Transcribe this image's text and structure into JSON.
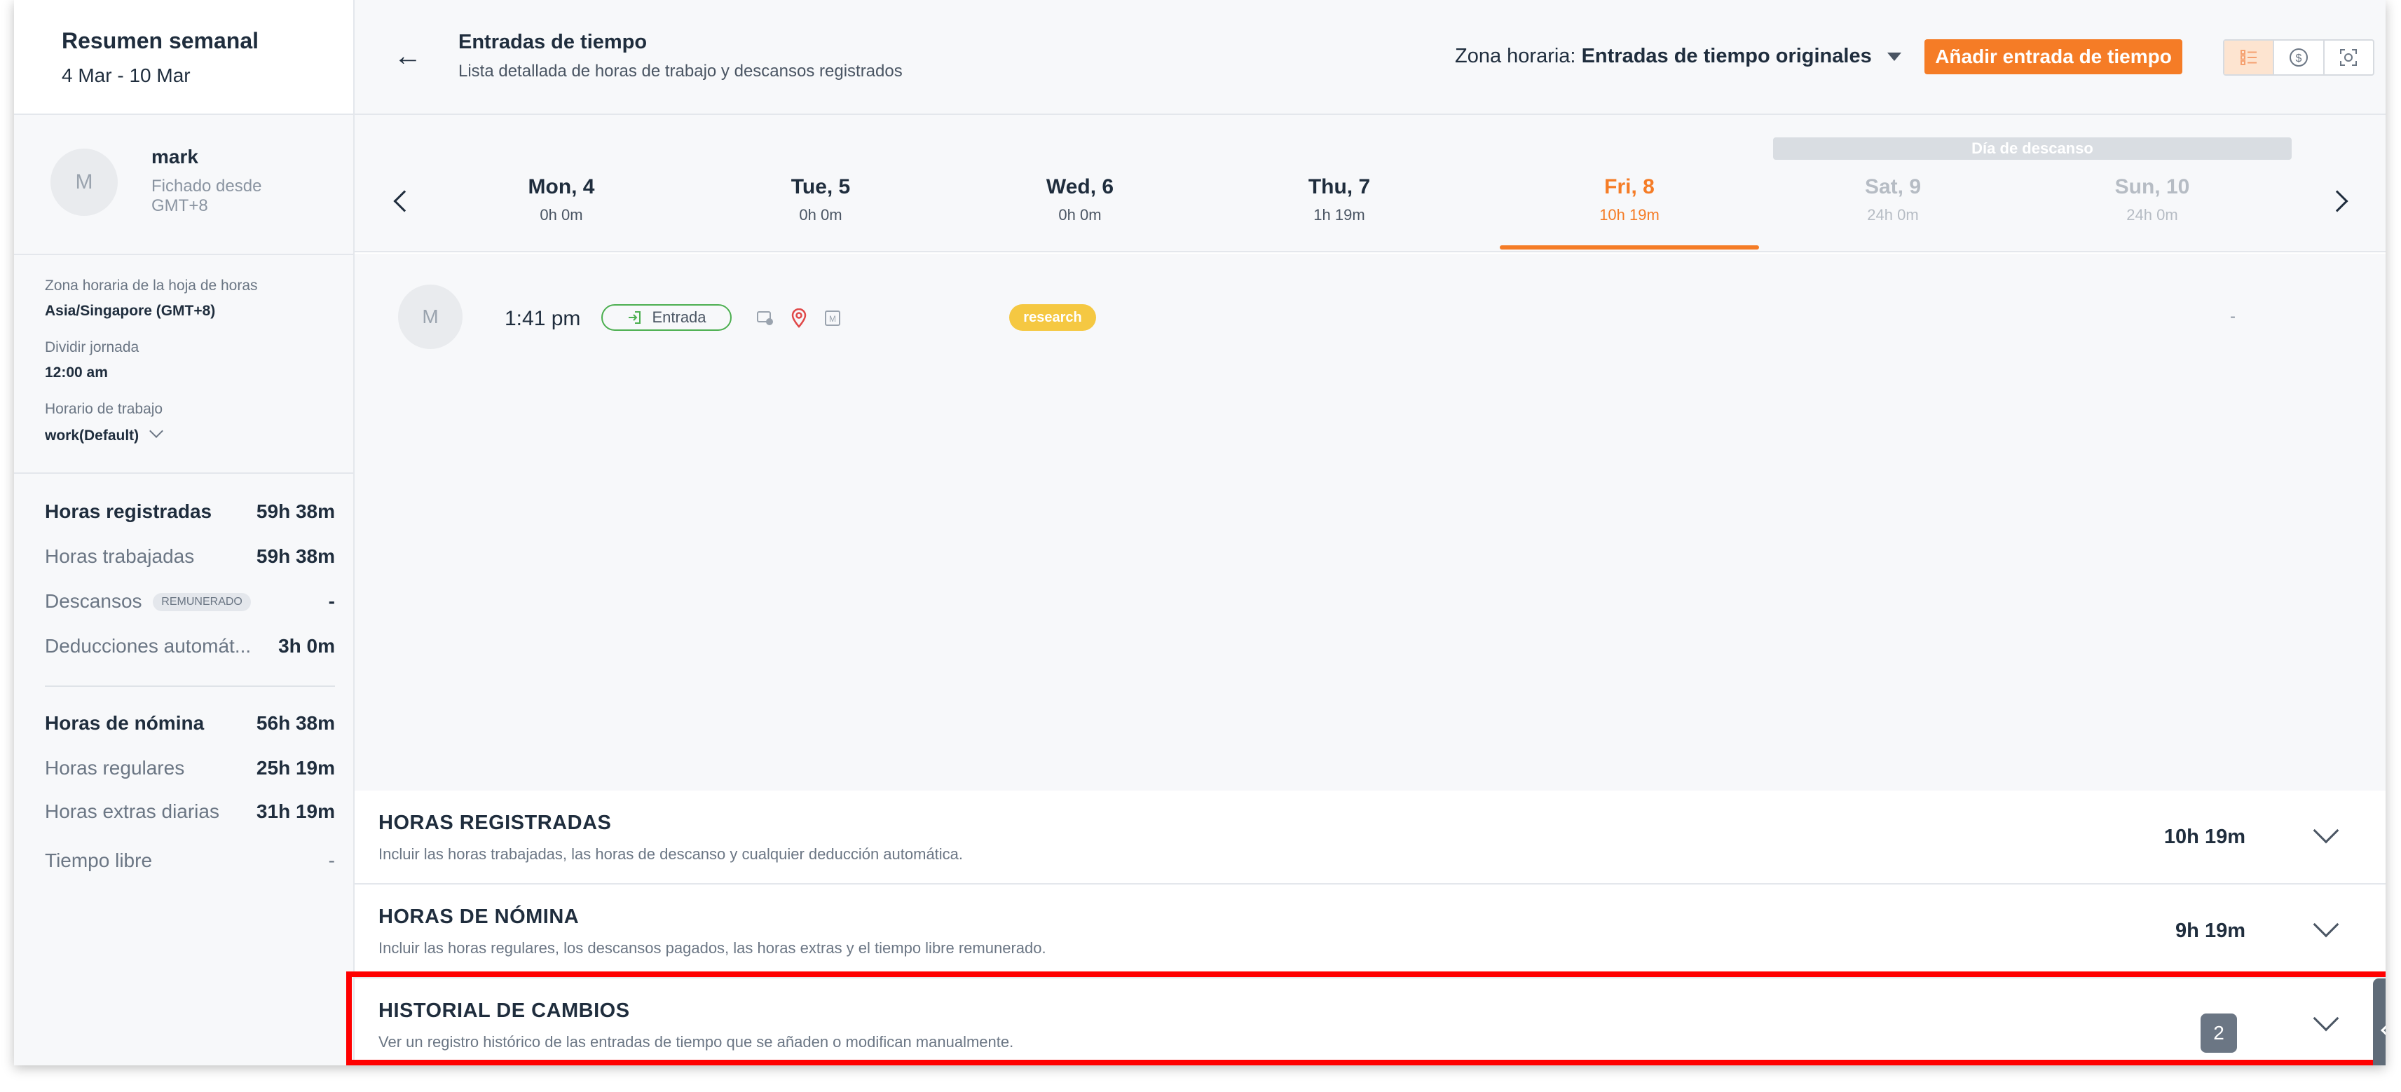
{
  "sidebar": {
    "title": "Resumen semanal",
    "date_range": "4 Mar - 10 Mar",
    "user": {
      "avatar_initial": "M",
      "name": "mark",
      "clocked_since": "Fichado desde GMT+8"
    },
    "settings": [
      {
        "label": "Zona horaria de la hoja de horas",
        "value": "Asia/Singapore (GMT+8)"
      },
      {
        "label": "Dividir jornada",
        "value": "12:00 am"
      },
      {
        "label": "Horario de trabajo",
        "value": "work(Default)"
      }
    ],
    "stats_group1": [
      {
        "label": "Horas registradas",
        "value": "59h 38m"
      },
      {
        "label": "Horas trabajadas",
        "value": "59h 38m"
      },
      {
        "label": "Descansos",
        "badge": "REMUNERADO",
        "value": "-"
      },
      {
        "label": "Deducciones automát...",
        "value": "3h 0m"
      }
    ],
    "stats_group2": [
      {
        "label": "Horas de nómina",
        "value": "56h 38m"
      },
      {
        "label": "Horas regulares",
        "value": "25h 19m"
      },
      {
        "label": "Horas extras diarias",
        "value": "31h 19m"
      },
      {
        "label": "Tiempo libre",
        "value": "-"
      }
    ]
  },
  "header": {
    "back_icon": "arrow-left-icon",
    "title": "Entradas de tiempo",
    "subtitle": "Lista detallada de horas de trabajo y descansos registrados",
    "timezone_label": "Zona horaria:",
    "timezone_value": "Entradas de tiempo originales",
    "add_button": "Añadir entrada de tiempo",
    "view_icons": [
      "list-icon",
      "dollar-icon",
      "scan-face-icon"
    ]
  },
  "week": {
    "rest_label": "Día de descanso",
    "days": [
      {
        "name": "Mon, 4",
        "hours": "0h 0m"
      },
      {
        "name": "Tue, 5",
        "hours": "0h 0m"
      },
      {
        "name": "Wed, 6",
        "hours": "0h 0m"
      },
      {
        "name": "Thu, 7",
        "hours": "1h 19m"
      },
      {
        "name": "Fri, 8",
        "hours": "10h 19m"
      },
      {
        "name": "Sat, 9",
        "hours": "24h 0m"
      },
      {
        "name": "Sun, 10",
        "hours": "24h 0m"
      }
    ],
    "active_day": "Fri, 8"
  },
  "entry": {
    "avatar_initial": "M",
    "time": "1:41 pm",
    "type_label": "Entrada",
    "icons": [
      "device-icon",
      "location-pin-icon",
      "manual-icon"
    ],
    "tag": "research",
    "note": "-"
  },
  "sections": [
    {
      "title": "HORAS REGISTRADAS",
      "desc": "Incluir las horas trabajadas, las horas de descanso y cualquier deducción automática.",
      "value": "10h 19m"
    },
    {
      "title": "HORAS DE NÓMINA",
      "desc": "Incluir las horas regulares, los descansos pagados, las horas extras y el tiempo libre remunerado.",
      "value": "9h 19m"
    },
    {
      "title": "HISTORIAL DE CAMBIOS",
      "desc": "Ver un registro histórico de las entradas de tiempo que se añaden o modifican manualmente.",
      "count": "2"
    }
  ],
  "colors": {
    "accent": "#f57c26",
    "highlight": "#ff0000",
    "tag": "#f5c842",
    "entry_in": "#4caf50"
  }
}
